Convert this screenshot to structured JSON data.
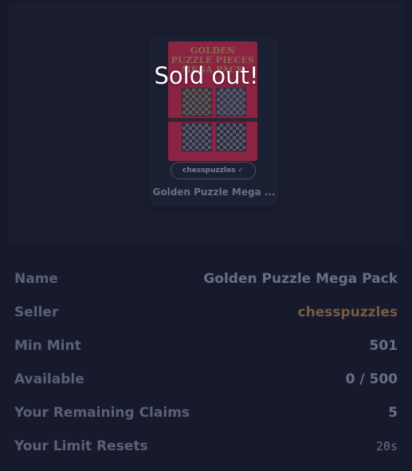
{
  "overlay": {
    "sold_out_text": "Sold out!"
  },
  "card": {
    "pack_title": "GOLDEN PUZZLE PIECES MEGA PACK",
    "seller": "chesspuzzles",
    "verified_icon": "check-icon",
    "name": "Golden Puzzle Mega ..."
  },
  "details": {
    "rows": [
      {
        "label": "Name",
        "value": "Golden Puzzle Mega Pack"
      },
      {
        "label": "Seller",
        "value": "chesspuzzles"
      },
      {
        "label": "Min Mint",
        "value": "501"
      },
      {
        "label": "Available",
        "value": "0 / 500"
      },
      {
        "label": "Your Remaining Claims",
        "value": "5"
      },
      {
        "label": "Your Limit Resets",
        "value": "20s"
      }
    ]
  },
  "colors": {
    "background": "#161a2c",
    "seller_accent": "#7a5a44",
    "pack_red": "#b02548"
  }
}
